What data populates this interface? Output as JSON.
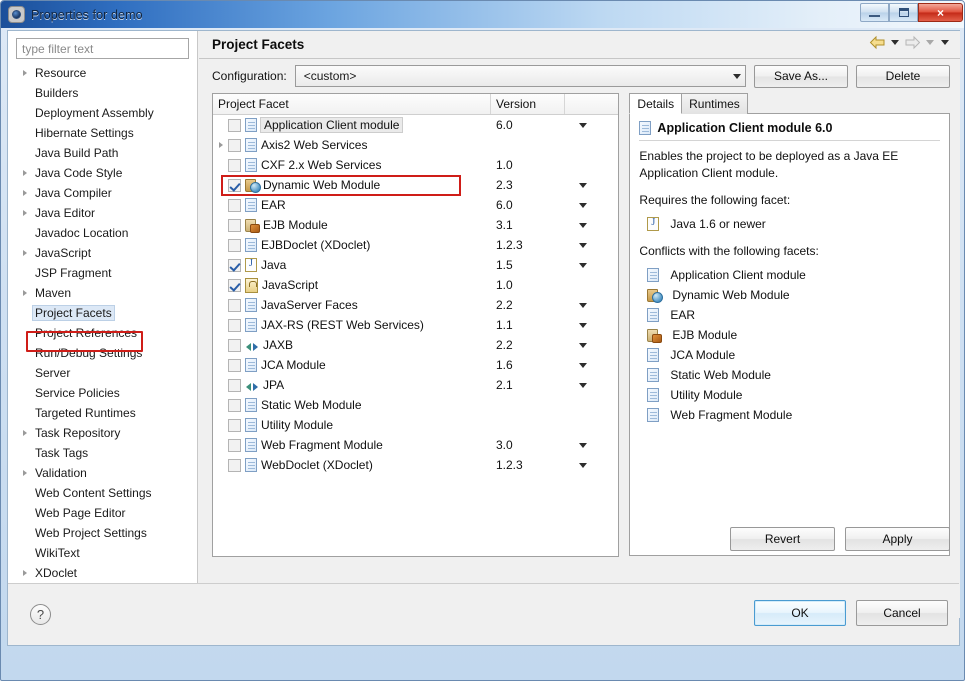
{
  "window": {
    "title": "Properties for demo",
    "icon": "properties-icon",
    "controls": {
      "minimize": "minimize-icon",
      "restore": "restore-icon",
      "close": "×"
    }
  },
  "sidebar": {
    "filter_placeholder": "type filter text",
    "items": [
      {
        "label": "Resource",
        "expandable": true,
        "selected": false
      },
      {
        "label": "Builders",
        "expandable": false,
        "selected": false
      },
      {
        "label": "Deployment Assembly",
        "expandable": false,
        "selected": false
      },
      {
        "label": "Hibernate Settings",
        "expandable": false,
        "selected": false
      },
      {
        "label": "Java Build Path",
        "expandable": false,
        "selected": false
      },
      {
        "label": "Java Code Style",
        "expandable": true,
        "selected": false
      },
      {
        "label": "Java Compiler",
        "expandable": true,
        "selected": false
      },
      {
        "label": "Java Editor",
        "expandable": true,
        "selected": false
      },
      {
        "label": "Javadoc Location",
        "expandable": false,
        "selected": false
      },
      {
        "label": "JavaScript",
        "expandable": true,
        "selected": false
      },
      {
        "label": "JSP Fragment",
        "expandable": false,
        "selected": false
      },
      {
        "label": "Maven",
        "expandable": true,
        "selected": false
      },
      {
        "label": "Project Facets",
        "expandable": false,
        "selected": true
      },
      {
        "label": "Project References",
        "expandable": false,
        "selected": false
      },
      {
        "label": "Run/Debug Settings",
        "expandable": false,
        "selected": false
      },
      {
        "label": "Server",
        "expandable": false,
        "selected": false
      },
      {
        "label": "Service Policies",
        "expandable": false,
        "selected": false
      },
      {
        "label": "Targeted Runtimes",
        "expandable": false,
        "selected": false
      },
      {
        "label": "Task Repository",
        "expandable": true,
        "selected": false
      },
      {
        "label": "Task Tags",
        "expandable": false,
        "selected": false
      },
      {
        "label": "Validation",
        "expandable": true,
        "selected": false
      },
      {
        "label": "Web Content Settings",
        "expandable": false,
        "selected": false
      },
      {
        "label": "Web Page Editor",
        "expandable": false,
        "selected": false
      },
      {
        "label": "Web Project Settings",
        "expandable": false,
        "selected": false
      },
      {
        "label": "WikiText",
        "expandable": false,
        "selected": false
      },
      {
        "label": "XDoclet",
        "expandable": true,
        "selected": false
      }
    ]
  },
  "page": {
    "title": "Project Facets",
    "nav": {
      "back": "back-arrow-icon",
      "back_menu": "chevron-down-icon",
      "forward": "forward-arrow-icon",
      "forward_menu": "chevron-down-icon",
      "view_menu": "chevron-down-icon"
    }
  },
  "configuration": {
    "label": "Configuration:",
    "value": "<custom>",
    "save_as_label": "Save As...",
    "delete_label": "Delete"
  },
  "facet_table": {
    "columns": [
      "Project Facet",
      "Version",
      ""
    ],
    "rows": [
      {
        "name": "Application Client module",
        "version": "6.0",
        "checked": false,
        "expandable": false,
        "icon": "doc",
        "has_version_menu": true,
        "highlighted": true
      },
      {
        "name": "Axis2 Web Services",
        "version": "",
        "checked": false,
        "expandable": true,
        "icon": "doc",
        "has_version_menu": false,
        "highlighted": false
      },
      {
        "name": "CXF 2.x Web Services",
        "version": "1.0",
        "checked": false,
        "expandable": false,
        "icon": "doc",
        "has_version_menu": false,
        "highlighted": false
      },
      {
        "name": "Dynamic Web Module",
        "version": "2.3",
        "checked": true,
        "expandable": false,
        "icon": "web",
        "has_version_menu": true,
        "highlighted": false
      },
      {
        "name": "EAR",
        "version": "6.0",
        "checked": false,
        "expandable": false,
        "icon": "doc",
        "has_version_menu": true,
        "highlighted": false
      },
      {
        "name": "EJB Module",
        "version": "3.1",
        "checked": false,
        "expandable": false,
        "icon": "ejb",
        "has_version_menu": true,
        "highlighted": false
      },
      {
        "name": "EJBDoclet (XDoclet)",
        "version": "1.2.3",
        "checked": false,
        "expandable": false,
        "icon": "doc",
        "has_version_menu": true,
        "highlighted": false
      },
      {
        "name": "Java",
        "version": "1.5",
        "checked": true,
        "expandable": false,
        "icon": "java",
        "has_version_menu": true,
        "highlighted": false
      },
      {
        "name": "JavaScript",
        "version": "1.0",
        "checked": true,
        "expandable": false,
        "icon": "js",
        "has_version_menu": false,
        "highlighted": false
      },
      {
        "name": "JavaServer Faces",
        "version": "2.2",
        "checked": false,
        "expandable": false,
        "icon": "doc",
        "has_version_menu": true,
        "highlighted": false
      },
      {
        "name": "JAX-RS (REST Web Services)",
        "version": "1.1",
        "checked": false,
        "expandable": false,
        "icon": "doc",
        "has_version_menu": true,
        "highlighted": false
      },
      {
        "name": "JAXB",
        "version": "2.2",
        "checked": false,
        "expandable": false,
        "icon": "arrows",
        "has_version_menu": true,
        "highlighted": false
      },
      {
        "name": "JCA Module",
        "version": "1.6",
        "checked": false,
        "expandable": false,
        "icon": "doc",
        "has_version_menu": true,
        "highlighted": false
      },
      {
        "name": "JPA",
        "version": "2.1",
        "checked": false,
        "expandable": false,
        "icon": "arrows",
        "has_version_menu": true,
        "highlighted": false
      },
      {
        "name": "Static Web Module",
        "version": "",
        "checked": false,
        "expandable": false,
        "icon": "doc",
        "has_version_menu": false,
        "highlighted": false
      },
      {
        "name": "Utility Module",
        "version": "",
        "checked": false,
        "expandable": false,
        "icon": "doc",
        "has_version_menu": false,
        "highlighted": false
      },
      {
        "name": "Web Fragment Module",
        "version": "3.0",
        "checked": false,
        "expandable": false,
        "icon": "doc",
        "has_version_menu": true,
        "highlighted": false
      },
      {
        "name": "WebDoclet (XDoclet)",
        "version": "1.2.3",
        "checked": false,
        "expandable": false,
        "icon": "doc",
        "has_version_menu": true,
        "highlighted": false
      }
    ]
  },
  "details": {
    "tabs": [
      {
        "label": "Details",
        "active": true
      },
      {
        "label": "Runtimes",
        "active": false
      }
    ],
    "facet_title": "Application Client module 6.0",
    "facet_icon": "doc",
    "description": "Enables the project to be deployed as a Java EE Application Client module.",
    "requires_heading": "Requires the following facet:",
    "requires": [
      {
        "label": "Java 1.6 or newer",
        "icon": "java"
      }
    ],
    "conflicts_heading": "Conflicts with the following facets:",
    "conflicts": [
      {
        "label": "Application Client module",
        "icon": "doc"
      },
      {
        "label": "Dynamic Web Module",
        "icon": "web"
      },
      {
        "label": "EAR",
        "icon": "doc"
      },
      {
        "label": "EJB Module",
        "icon": "ejb"
      },
      {
        "label": "JCA Module",
        "icon": "doc"
      },
      {
        "label": "Static Web Module",
        "icon": "doc"
      },
      {
        "label": "Utility Module",
        "icon": "doc"
      },
      {
        "label": "Web Fragment Module",
        "icon": "doc"
      }
    ]
  },
  "actions": {
    "revert_label": "Revert",
    "apply_label": "Apply",
    "ok_label": "OK",
    "cancel_label": "Cancel",
    "help_label": "?"
  },
  "annotations": {
    "highlight_color": "#cf1d18",
    "boxes": [
      "project-facets-sidebar-item",
      "dynamic-web-module-row"
    ]
  }
}
